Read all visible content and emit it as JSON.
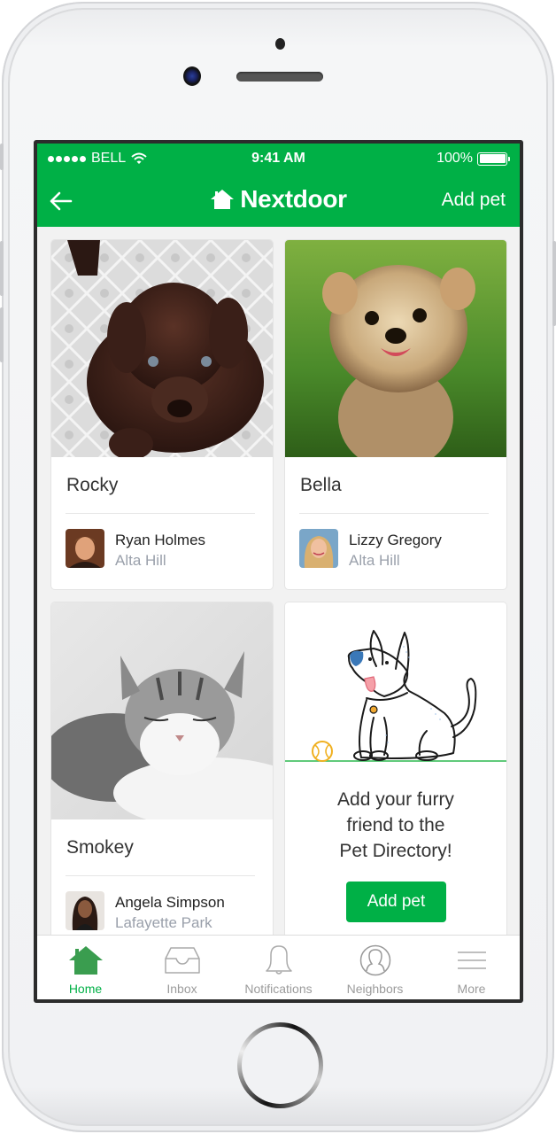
{
  "status_bar": {
    "carrier": "BELL",
    "signal_dots": 5,
    "wifi_icon": "wifi-icon",
    "time": "9:41 AM",
    "battery_percent_label": "100%",
    "battery_level": 1.0
  },
  "nav": {
    "back_icon": "arrow-left-icon",
    "logo_icon": "house-icon",
    "title": "Nextdoor",
    "action_label": "Add pet"
  },
  "colors": {
    "brand_green": "#00b046",
    "tab_active": "#3a9d4f",
    "tab_inactive": "#9b9b9b",
    "secondary_text": "#9aa0ab"
  },
  "pets": [
    {
      "name": "Rocky",
      "photo": "chocolate-labrador-puppy-photo",
      "owner": {
        "name": "Ryan Holmes",
        "neighborhood": "Alta Hill",
        "avatar": "ryan-holmes-avatar"
      }
    },
    {
      "name": "Bella",
      "photo": "yorkshire-terrier-photo",
      "owner": {
        "name": "Lizzy Gregory",
        "neighborhood": "Alta Hill",
        "avatar": "lizzy-gregory-avatar"
      }
    },
    {
      "name": "Smokey",
      "photo": "tabby-cat-photo",
      "owner": {
        "name": "Angela Simpson",
        "neighborhood": "Lafayette Park",
        "avatar": "angela-simpson-avatar"
      }
    }
  ],
  "promo": {
    "illustration": "dog-with-ball-illustration",
    "line1": "Add your furry",
    "line2": "friend to the",
    "line3": "Pet Directory!",
    "button_label": "Add pet"
  },
  "tabs": [
    {
      "label": "Home",
      "icon": "home-icon",
      "active": true
    },
    {
      "label": "Inbox",
      "icon": "inbox-icon",
      "active": false
    },
    {
      "label": "Notifications",
      "icon": "bell-icon",
      "active": false
    },
    {
      "label": "Neighbors",
      "icon": "person-circle-icon",
      "active": false
    },
    {
      "label": "More",
      "icon": "hamburger-menu-icon",
      "active": false
    }
  ]
}
